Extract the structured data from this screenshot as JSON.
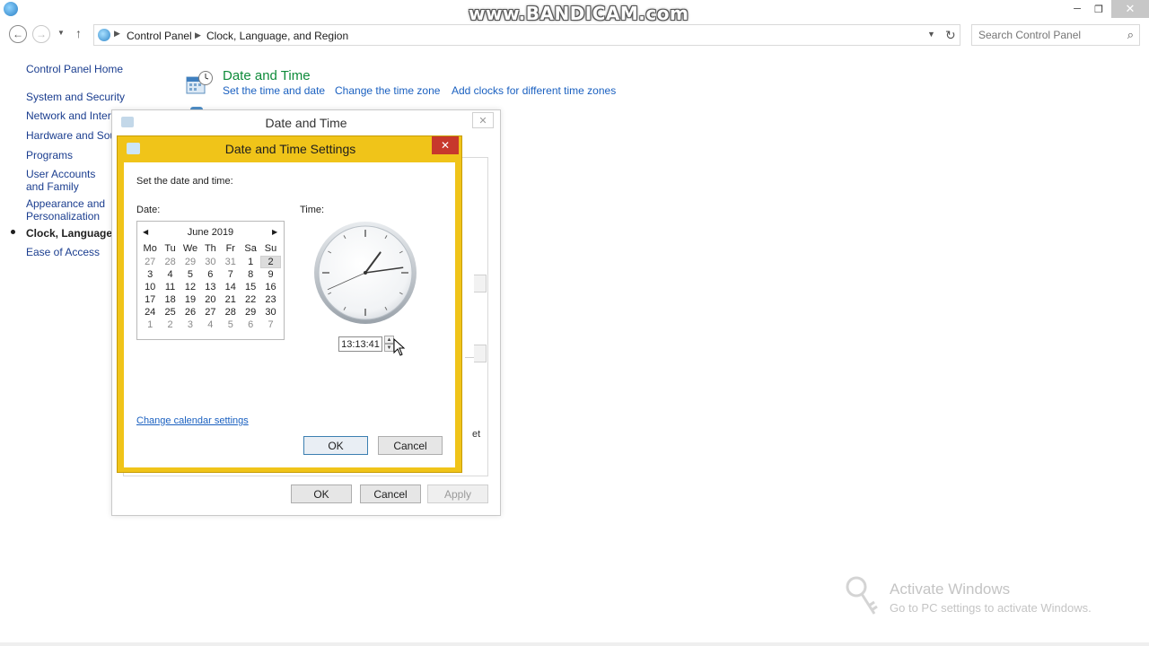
{
  "watermark": "www.BANDICAM.com",
  "window_controls": {
    "minimize": "─",
    "maximize": "❐",
    "close": "✕"
  },
  "address_bar": {
    "breadcrumbs": [
      "Control Panel",
      "Clock, Language, and Region"
    ],
    "separator": "▶",
    "dropdown": "▼",
    "refresh": "↻"
  },
  "search": {
    "placeholder": "Search Control Panel",
    "icon": "search-icon"
  },
  "sidebar": {
    "home": "Control Panel Home",
    "items": [
      {
        "label": "System and Security"
      },
      {
        "label": "Network and Internet"
      },
      {
        "label": "Hardware and Sound"
      },
      {
        "label": "Programs"
      },
      {
        "label": "User Accounts and Family Safety"
      },
      {
        "label": "Appearance and Personalization"
      },
      {
        "label": "Clock, Language, and Region",
        "active": true
      },
      {
        "label": "Ease of Access"
      }
    ]
  },
  "main": {
    "section_title": "Date and Time",
    "tasks": [
      "Set the time and date",
      "Change the time zone",
      "Add clocks for different time zones"
    ]
  },
  "dt_dialog": {
    "title": "Date and Time",
    "close": "✕",
    "fragment_text": "et",
    "buttons": {
      "ok": "OK",
      "cancel": "Cancel",
      "apply": "Apply"
    }
  },
  "dts_dialog": {
    "title": "Date and Time Settings",
    "close": "✕",
    "instruction": "Set the date and time:",
    "date_label": "Date:",
    "time_label": "Time:",
    "calendar": {
      "month": "June 2019",
      "prev": "◀",
      "next": "▶",
      "weekdays": [
        "Mo",
        "Tu",
        "We",
        "Th",
        "Fr",
        "Sa",
        "Su"
      ],
      "days": [
        "27",
        "28",
        "29",
        "30",
        "31",
        "1",
        "2",
        "3",
        "4",
        "5",
        "6",
        "7",
        "8",
        "9",
        "10",
        "11",
        "12",
        "13",
        "14",
        "15",
        "16",
        "17",
        "18",
        "19",
        "20",
        "21",
        "22",
        "23",
        "24",
        "25",
        "26",
        "27",
        "28",
        "29",
        "30",
        "1",
        "2",
        "3",
        "4",
        "5",
        "6",
        "7"
      ],
      "other_month_indices": [
        0,
        1,
        2,
        3,
        4,
        35,
        36,
        37,
        38,
        39,
        40,
        41
      ],
      "selected_index": 6
    },
    "clock": {
      "hours": 13,
      "minutes": 13,
      "seconds": 41
    },
    "time_value": "13:13:41",
    "spin_up": "▲",
    "spin_down": "▼",
    "change_calendar_link": "Change calendar settings",
    "buttons": {
      "ok": "OK",
      "cancel": "Cancel"
    }
  },
  "activation": {
    "title": "Activate Windows",
    "subtitle": "Go to PC settings to activate Windows."
  }
}
